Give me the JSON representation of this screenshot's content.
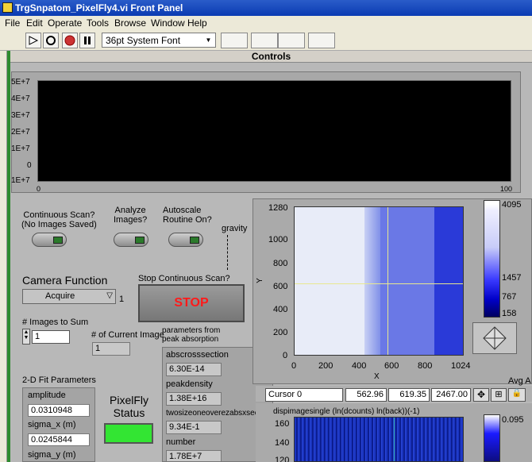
{
  "window": {
    "title": "TrgSnpatom_PixelFly4.vi Front Panel"
  },
  "menu": [
    "File",
    "Edit",
    "Operate",
    "Tools",
    "Browse",
    "Window",
    "Help"
  ],
  "toolbar": {
    "font": "36pt System Font"
  },
  "panel": {
    "header": "Controls"
  },
  "chart": {
    "y_ticks": [
      "5E+7",
      "4E+7",
      "3E+7",
      "2E+7",
      "1E+7",
      "0",
      "1E+7"
    ],
    "x_ticks": [
      "0",
      "100"
    ]
  },
  "controls": {
    "continuous_scan": "Continuous Scan?\n(No Images Saved)",
    "analyze_images": "Analyze\nImages?",
    "autoscale": "Autoscale\nRoutine On?",
    "gravity": "gravity",
    "camera_function_label": "Camera Function",
    "camera_function_value": "Acquire",
    "camera_function_index": "1",
    "stop_label": "Stop Continuous Scan?",
    "stop_button": "STOP",
    "images_to_sum_label": "# Images to Sum",
    "images_to_sum_value": "1",
    "current_image_label": "# of Current Image",
    "current_image_value": "1",
    "params_label": "parameters from\npeak absorption",
    "pixelfly_status_label": "PixelFly\nStatus"
  },
  "fit": {
    "title": "2-D Fit Parameters",
    "fields": [
      {
        "label": "amplitude",
        "value": "0.0310948"
      },
      {
        "label": "sigma_x (m)",
        "value": "0.0245844"
      },
      {
        "label": "sigma_y (m)",
        "value": ""
      }
    ]
  },
  "params": [
    {
      "label": "abscrosssection",
      "value": "6.30E-14"
    },
    {
      "label": "peakdensity",
      "value": "1.38E+16"
    },
    {
      "label": "twosizeoneoverezabsxsecdens",
      "value": "9.34E-1"
    },
    {
      "label": "number",
      "value": "1.78E+7"
    }
  ],
  "intensity_graph": {
    "y_ticks": [
      "1280",
      "1000",
      "800",
      "600",
      "400",
      "200",
      "0"
    ],
    "x_ticks": [
      "0",
      "200",
      "400",
      "600",
      "800",
      "1024"
    ],
    "xlabel": "X",
    "ylabel": "Y",
    "colorbar_ticks": [
      "4095",
      "1457",
      "767",
      "158"
    ],
    "cursor": {
      "name": "Cursor 0",
      "x": "562.96",
      "y": "619.35",
      "z": "2467.00"
    },
    "side_label": "Avg A"
  },
  "lower_graph": {
    "title": "dispimagesingle (ln(dcounts) ln(back))(-1)",
    "y_ticks": [
      "160",
      "140",
      "120"
    ],
    "colorbar_top": "0.095"
  },
  "chart_data": {
    "type": "heatmap",
    "title": "",
    "xlabel": "X",
    "ylabel": "Y",
    "xlim": [
      0,
      1024
    ],
    "ylim": [
      0,
      1280
    ],
    "colorbar": [
      158,
      767,
      1457,
      4095
    ],
    "cursor": {
      "x": 562.96,
      "y": 619.35,
      "z": 2467.0
    }
  }
}
